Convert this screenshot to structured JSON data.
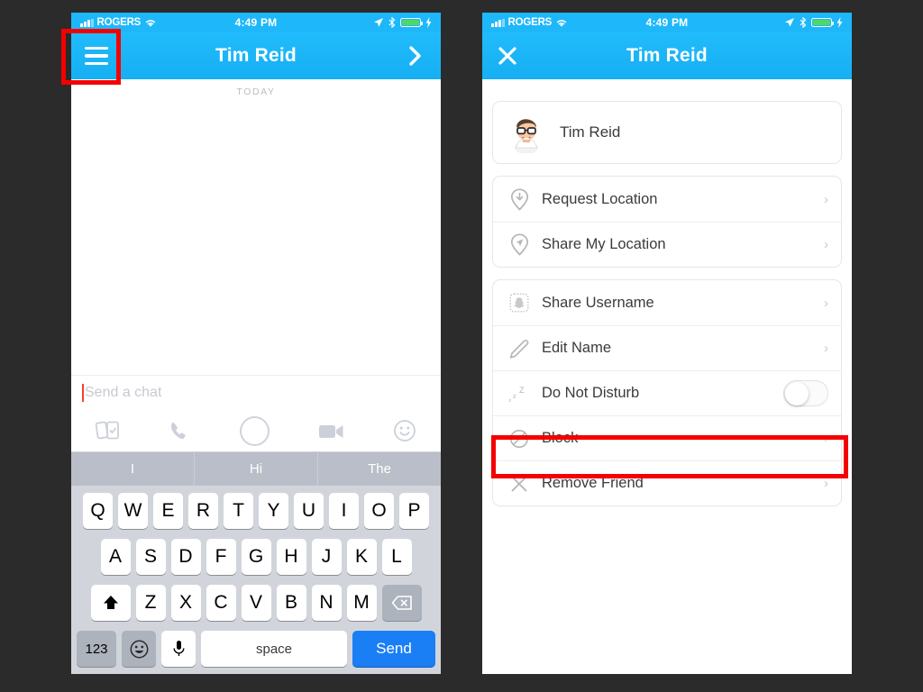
{
  "colors": {
    "background": "#2b2b2b",
    "header_blue": "#1eb8fa",
    "send_blue": "#1a7ef5",
    "annotation_red": "#f40000",
    "battery_green": "#4cd964"
  },
  "status_bar": {
    "carrier": "ROGERS",
    "time": "4:49 PM",
    "icons": [
      "signal-bars-icon",
      "wifi-icon",
      "location-arrow-icon",
      "bluetooth-icon",
      "battery-icon",
      "charging-bolt-icon"
    ]
  },
  "left_phone": {
    "header": {
      "menu_icon": "hamburger-menu-icon",
      "title": "Tim Reid",
      "forward_icon": "chevron-right-icon"
    },
    "conversation": {
      "date_divider": "TODAY"
    },
    "chat_input": {
      "placeholder": "Send a chat",
      "value": "",
      "cursor_visible": true
    },
    "action_icons": [
      "photos-gallery-icon",
      "phone-call-icon",
      "camera-capture-icon",
      "video-call-icon",
      "sticker-emoji-icon"
    ],
    "suggestions": [
      "I",
      "Hi",
      "The"
    ],
    "keyboard": {
      "row1": [
        "Q",
        "W",
        "E",
        "R",
        "T",
        "Y",
        "U",
        "I",
        "O",
        "P"
      ],
      "row2": [
        "A",
        "S",
        "D",
        "F",
        "G",
        "H",
        "J",
        "K",
        "L"
      ],
      "row3": [
        "Z",
        "X",
        "C",
        "V",
        "B",
        "N",
        "M"
      ],
      "shift_key": "shift-icon",
      "delete_key": "backspace-icon",
      "numbers_key": "123",
      "emoji_key": "emoji-icon",
      "dictation_key": "microphone-icon",
      "space_key": "space",
      "send_key": "Send"
    }
  },
  "right_phone": {
    "header": {
      "close_icon": "close-x-icon",
      "title": "Tim Reid"
    },
    "profile": {
      "name": "Tim Reid",
      "avatar": "bitmoji-avatar"
    },
    "menu_groups": [
      {
        "items": [
          {
            "label": "Request Location",
            "icon": "location-request-icon",
            "accessory": "chevron"
          },
          {
            "label": "Share My Location",
            "icon": "location-share-icon",
            "accessory": "chevron"
          }
        ]
      },
      {
        "items": [
          {
            "label": "Share Username",
            "icon": "snapcode-icon",
            "accessory": "chevron"
          },
          {
            "label": "Edit Name",
            "icon": "pencil-edit-icon",
            "accessory": "chevron"
          },
          {
            "label": "Do Not Disturb",
            "icon": "sleep-zzz-icon",
            "accessory": "toggle",
            "toggle_on": false
          },
          {
            "label": "Block",
            "icon": "block-circle-icon",
            "accessory": "chevron"
          },
          {
            "label": "Remove Friend",
            "icon": "remove-x-icon",
            "accessory": "chevron",
            "highlighted": true
          }
        ]
      }
    ]
  }
}
